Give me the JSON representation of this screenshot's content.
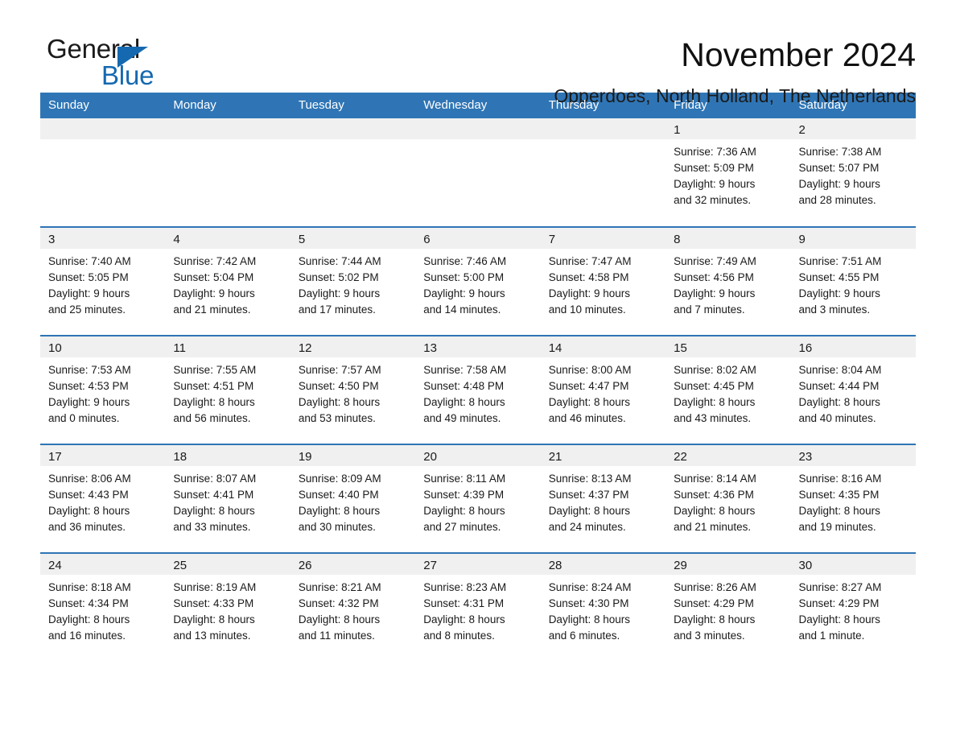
{
  "brand": {
    "word_one": "General",
    "word_two": "Blue",
    "flag_icon": "triangle-flag-icon",
    "accent_color": "#1569b0"
  },
  "header": {
    "month_title": "November 2024",
    "location": "Opperdoes, North Holland, The Netherlands"
  },
  "calendar": {
    "header_color": "#2f75b5",
    "daynum_band_color": "#f0f0f0",
    "weekdays": [
      "Sunday",
      "Monday",
      "Tuesday",
      "Wednesday",
      "Thursday",
      "Friday",
      "Saturday"
    ],
    "labels": {
      "sunrise": "Sunrise:",
      "sunset": "Sunset:",
      "daylight": "Daylight:"
    },
    "weeks": [
      [
        {
          "day": ""
        },
        {
          "day": ""
        },
        {
          "day": ""
        },
        {
          "day": ""
        },
        {
          "day": ""
        },
        {
          "day": "1",
          "sunrise": "Sunrise: 7:36 AM",
          "sunset": "Sunset: 5:09 PM",
          "daylight_line1": "Daylight: 9 hours",
          "daylight_line2": "and 32 minutes."
        },
        {
          "day": "2",
          "sunrise": "Sunrise: 7:38 AM",
          "sunset": "Sunset: 5:07 PM",
          "daylight_line1": "Daylight: 9 hours",
          "daylight_line2": "and 28 minutes."
        }
      ],
      [
        {
          "day": "3",
          "sunrise": "Sunrise: 7:40 AM",
          "sunset": "Sunset: 5:05 PM",
          "daylight_line1": "Daylight: 9 hours",
          "daylight_line2": "and 25 minutes."
        },
        {
          "day": "4",
          "sunrise": "Sunrise: 7:42 AM",
          "sunset": "Sunset: 5:04 PM",
          "daylight_line1": "Daylight: 9 hours",
          "daylight_line2": "and 21 minutes."
        },
        {
          "day": "5",
          "sunrise": "Sunrise: 7:44 AM",
          "sunset": "Sunset: 5:02 PM",
          "daylight_line1": "Daylight: 9 hours",
          "daylight_line2": "and 17 minutes."
        },
        {
          "day": "6",
          "sunrise": "Sunrise: 7:46 AM",
          "sunset": "Sunset: 5:00 PM",
          "daylight_line1": "Daylight: 9 hours",
          "daylight_line2": "and 14 minutes."
        },
        {
          "day": "7",
          "sunrise": "Sunrise: 7:47 AM",
          "sunset": "Sunset: 4:58 PM",
          "daylight_line1": "Daylight: 9 hours",
          "daylight_line2": "and 10 minutes."
        },
        {
          "day": "8",
          "sunrise": "Sunrise: 7:49 AM",
          "sunset": "Sunset: 4:56 PM",
          "daylight_line1": "Daylight: 9 hours",
          "daylight_line2": "and 7 minutes."
        },
        {
          "day": "9",
          "sunrise": "Sunrise: 7:51 AM",
          "sunset": "Sunset: 4:55 PM",
          "daylight_line1": "Daylight: 9 hours",
          "daylight_line2": "and 3 minutes."
        }
      ],
      [
        {
          "day": "10",
          "sunrise": "Sunrise: 7:53 AM",
          "sunset": "Sunset: 4:53 PM",
          "daylight_line1": "Daylight: 9 hours",
          "daylight_line2": "and 0 minutes."
        },
        {
          "day": "11",
          "sunrise": "Sunrise: 7:55 AM",
          "sunset": "Sunset: 4:51 PM",
          "daylight_line1": "Daylight: 8 hours",
          "daylight_line2": "and 56 minutes."
        },
        {
          "day": "12",
          "sunrise": "Sunrise: 7:57 AM",
          "sunset": "Sunset: 4:50 PM",
          "daylight_line1": "Daylight: 8 hours",
          "daylight_line2": "and 53 minutes."
        },
        {
          "day": "13",
          "sunrise": "Sunrise: 7:58 AM",
          "sunset": "Sunset: 4:48 PM",
          "daylight_line1": "Daylight: 8 hours",
          "daylight_line2": "and 49 minutes."
        },
        {
          "day": "14",
          "sunrise": "Sunrise: 8:00 AM",
          "sunset": "Sunset: 4:47 PM",
          "daylight_line1": "Daylight: 8 hours",
          "daylight_line2": "and 46 minutes."
        },
        {
          "day": "15",
          "sunrise": "Sunrise: 8:02 AM",
          "sunset": "Sunset: 4:45 PM",
          "daylight_line1": "Daylight: 8 hours",
          "daylight_line2": "and 43 minutes."
        },
        {
          "day": "16",
          "sunrise": "Sunrise: 8:04 AM",
          "sunset": "Sunset: 4:44 PM",
          "daylight_line1": "Daylight: 8 hours",
          "daylight_line2": "and 40 minutes."
        }
      ],
      [
        {
          "day": "17",
          "sunrise": "Sunrise: 8:06 AM",
          "sunset": "Sunset: 4:43 PM",
          "daylight_line1": "Daylight: 8 hours",
          "daylight_line2": "and 36 minutes."
        },
        {
          "day": "18",
          "sunrise": "Sunrise: 8:07 AM",
          "sunset": "Sunset: 4:41 PM",
          "daylight_line1": "Daylight: 8 hours",
          "daylight_line2": "and 33 minutes."
        },
        {
          "day": "19",
          "sunrise": "Sunrise: 8:09 AM",
          "sunset": "Sunset: 4:40 PM",
          "daylight_line1": "Daylight: 8 hours",
          "daylight_line2": "and 30 minutes."
        },
        {
          "day": "20",
          "sunrise": "Sunrise: 8:11 AM",
          "sunset": "Sunset: 4:39 PM",
          "daylight_line1": "Daylight: 8 hours",
          "daylight_line2": "and 27 minutes."
        },
        {
          "day": "21",
          "sunrise": "Sunrise: 8:13 AM",
          "sunset": "Sunset: 4:37 PM",
          "daylight_line1": "Daylight: 8 hours",
          "daylight_line2": "and 24 minutes."
        },
        {
          "day": "22",
          "sunrise": "Sunrise: 8:14 AM",
          "sunset": "Sunset: 4:36 PM",
          "daylight_line1": "Daylight: 8 hours",
          "daylight_line2": "and 21 minutes."
        },
        {
          "day": "23",
          "sunrise": "Sunrise: 8:16 AM",
          "sunset": "Sunset: 4:35 PM",
          "daylight_line1": "Daylight: 8 hours",
          "daylight_line2": "and 19 minutes."
        }
      ],
      [
        {
          "day": "24",
          "sunrise": "Sunrise: 8:18 AM",
          "sunset": "Sunset: 4:34 PM",
          "daylight_line1": "Daylight: 8 hours",
          "daylight_line2": "and 16 minutes."
        },
        {
          "day": "25",
          "sunrise": "Sunrise: 8:19 AM",
          "sunset": "Sunset: 4:33 PM",
          "daylight_line1": "Daylight: 8 hours",
          "daylight_line2": "and 13 minutes."
        },
        {
          "day": "26",
          "sunrise": "Sunrise: 8:21 AM",
          "sunset": "Sunset: 4:32 PM",
          "daylight_line1": "Daylight: 8 hours",
          "daylight_line2": "and 11 minutes."
        },
        {
          "day": "27",
          "sunrise": "Sunrise: 8:23 AM",
          "sunset": "Sunset: 4:31 PM",
          "daylight_line1": "Daylight: 8 hours",
          "daylight_line2": "and 8 minutes."
        },
        {
          "day": "28",
          "sunrise": "Sunrise: 8:24 AM",
          "sunset": "Sunset: 4:30 PM",
          "daylight_line1": "Daylight: 8 hours",
          "daylight_line2": "and 6 minutes."
        },
        {
          "day": "29",
          "sunrise": "Sunrise: 8:26 AM",
          "sunset": "Sunset: 4:29 PM",
          "daylight_line1": "Daylight: 8 hours",
          "daylight_line2": "and 3 minutes."
        },
        {
          "day": "30",
          "sunrise": "Sunrise: 8:27 AM",
          "sunset": "Sunset: 4:29 PM",
          "daylight_line1": "Daylight: 8 hours",
          "daylight_line2": "and 1 minute."
        }
      ]
    ]
  }
}
